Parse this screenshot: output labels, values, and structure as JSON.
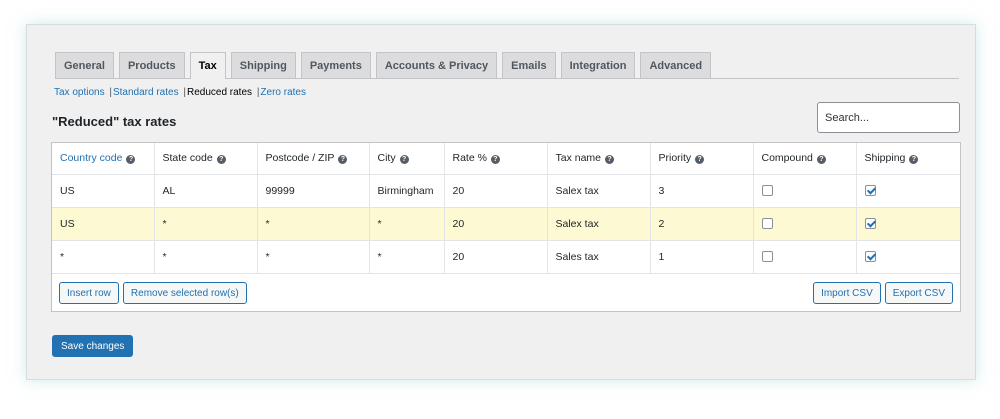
{
  "tabs": [
    {
      "label": "General",
      "active": false
    },
    {
      "label": "Products",
      "active": false
    },
    {
      "label": "Tax",
      "active": true
    },
    {
      "label": "Shipping",
      "active": false
    },
    {
      "label": "Payments",
      "active": false
    },
    {
      "label": "Accounts & Privacy",
      "active": false
    },
    {
      "label": "Emails",
      "active": false
    },
    {
      "label": "Integration",
      "active": false
    },
    {
      "label": "Advanced",
      "active": false
    }
  ],
  "subnav": {
    "items": [
      "Tax options",
      "Standard rates",
      "Reduced rates",
      "Zero rates"
    ],
    "separator": "|",
    "current_index": 2
  },
  "page_title": "\"Reduced\" tax rates",
  "search": {
    "placeholder": "Search..."
  },
  "table": {
    "columns": [
      "Country code",
      "State code",
      "Postcode / ZIP",
      "City",
      "Rate %",
      "Tax name",
      "Priority",
      "Compound",
      "Shipping"
    ],
    "rows": [
      {
        "country": "US",
        "state": "AL",
        "postcode": "99999",
        "city": "Birmingham",
        "rate": "20",
        "tax_name": "Salex tax",
        "priority": "3",
        "compound": false,
        "shipping": true,
        "highlight": false
      },
      {
        "country": "US",
        "state": "*",
        "postcode": "*",
        "city": "*",
        "rate": "20",
        "tax_name": "Salex tax",
        "priority": "2",
        "compound": false,
        "shipping": true,
        "highlight": true
      },
      {
        "country": "*",
        "state": "*",
        "postcode": "*",
        "city": "*",
        "rate": "20",
        "tax_name": "Sales tax",
        "priority": "1",
        "compound": false,
        "shipping": true,
        "highlight": false
      }
    ]
  },
  "buttons": {
    "insert_row": "Insert row",
    "remove_selected": "Remove selected row(s)",
    "import_csv": "Import CSV",
    "export_csv": "Export CSV",
    "save_changes": "Save changes"
  },
  "icons": {
    "help": "help-icon",
    "checkbox": "checkbox"
  },
  "colors": {
    "accent": "#2271b1",
    "highlight_row": "#fcf9d3",
    "panel_bg": "#f0f0f1"
  }
}
